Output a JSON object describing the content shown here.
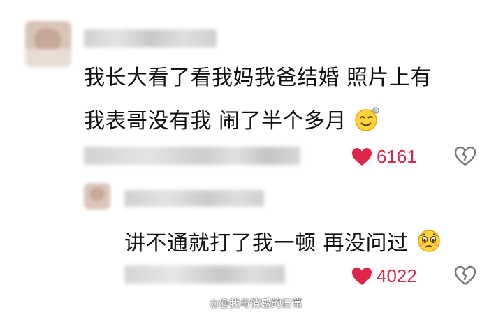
{
  "comment": {
    "line1": "我长大看了看我妈我爸结婚 照片上有",
    "line2": "我表哥没有我 闹了半个多月",
    "likes": "6161"
  },
  "reply": {
    "text": "讲不通就打了我一顿 再没问过",
    "likes": "4022"
  },
  "watermark": "@我与情感的日常",
  "colors": {
    "like_red": "#e0244a",
    "text": "#111111",
    "icon_gray": "#777777"
  }
}
